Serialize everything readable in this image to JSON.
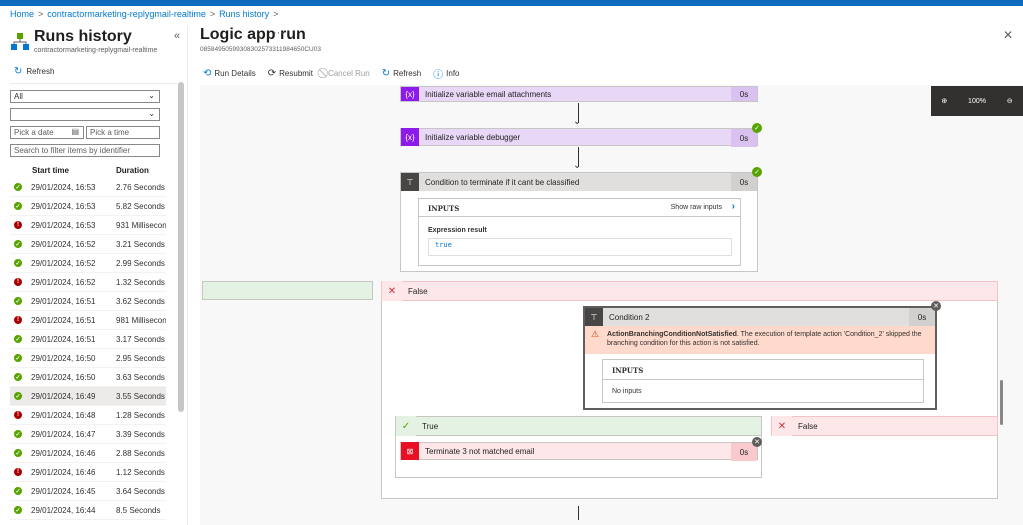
{
  "breadcrumb": {
    "home": "Home",
    "app": "contractormarketing-replygmail-realtime",
    "page": "Runs history",
    "trail_sep": ">"
  },
  "left": {
    "title": "Runs history",
    "subtitle": "contractormarketing-replygmail-realtime",
    "collapse": "«",
    "refresh": "Refresh",
    "filter_status": "All",
    "filter_blank": "",
    "date_placeholder": "Pick a date",
    "time_placeholder": "Pick a time",
    "search_placeholder": "Search to filter items by identifier",
    "col_start": "Start time",
    "col_duration": "Duration",
    "runs": [
      {
        "status": "ok",
        "time": "29/01/2024, 16:53",
        "duration": "2.76 Seconds"
      },
      {
        "status": "ok",
        "time": "29/01/2024, 16:53",
        "duration": "5.82 Seconds"
      },
      {
        "status": "err",
        "time": "29/01/2024, 16:53",
        "duration": "931 Milliseconds"
      },
      {
        "status": "ok",
        "time": "29/01/2024, 16:52",
        "duration": "3.21 Seconds"
      },
      {
        "status": "ok",
        "time": "29/01/2024, 16:52",
        "duration": "2.99 Seconds"
      },
      {
        "status": "err",
        "time": "29/01/2024, 16:52",
        "duration": "1.32 Seconds"
      },
      {
        "status": "ok",
        "time": "29/01/2024, 16:51",
        "duration": "3.62 Seconds"
      },
      {
        "status": "err",
        "time": "29/01/2024, 16:51",
        "duration": "981 Milliseconds"
      },
      {
        "status": "ok",
        "time": "29/01/2024, 16:51",
        "duration": "3.17 Seconds"
      },
      {
        "status": "ok",
        "time": "29/01/2024, 16:50",
        "duration": "2.95 Seconds"
      },
      {
        "status": "ok",
        "time": "29/01/2024, 16:50",
        "duration": "3.63 Seconds"
      },
      {
        "status": "ok",
        "time": "29/01/2024, 16:49",
        "duration": "3.55 Seconds"
      },
      {
        "status": "err",
        "time": "29/01/2024, 16:48",
        "duration": "1.28 Seconds"
      },
      {
        "status": "ok",
        "time": "29/01/2024, 16:47",
        "duration": "3.39 Seconds"
      },
      {
        "status": "ok",
        "time": "29/01/2024, 16:46",
        "duration": "2.88 Seconds"
      },
      {
        "status": "err",
        "time": "29/01/2024, 16:46",
        "duration": "1.12 Seconds"
      },
      {
        "status": "ok",
        "time": "29/01/2024, 16:45",
        "duration": "3.64 Seconds"
      },
      {
        "status": "ok",
        "time": "29/01/2024, 16:44",
        "duration": "8.5 Seconds"
      }
    ],
    "selected_index": 11
  },
  "main": {
    "title": "Logic app run",
    "more": "···",
    "run_id": "08584950599308302573311984650CU03",
    "close": "✕",
    "toolbar": {
      "run_details": "Run Details",
      "resubmit": "Resubmit",
      "cancel_run": "Cancel Run",
      "refresh": "Refresh",
      "info": "Info"
    },
    "zoom": {
      "level": "100%",
      "in": "⊕",
      "out": "⊖"
    }
  },
  "flow": {
    "var_attachments": {
      "label": "Initialize variable email attachments",
      "duration": "0s",
      "icon": "{x}"
    },
    "var_debugger": {
      "label": "Initialize variable debugger",
      "duration": "0s",
      "icon": "{x}"
    },
    "condition": {
      "label": "Condition to terminate if it cant be classified",
      "duration": "0s",
      "inputs_label": "INPUTS",
      "show_raw": "Show raw inputs",
      "expr_label": "Expression result",
      "expr_value": "true"
    },
    "false_branch": "False",
    "condition2": {
      "label": "Condition 2",
      "duration": "0s",
      "warn_bold": "ActionBranchingConditionNotSatisfied",
      "warn_text": ". The execution of template action 'Condition_2' skipped the branching condition for this action is not satisfied.",
      "inputs_label": "INPUTS",
      "no_inputs": "No inputs"
    },
    "true_branch": "True",
    "false_branch2": "False",
    "terminate": {
      "label": "Terminate 3 not matched email",
      "duration": "0s"
    }
  },
  "colors": {
    "accent": "#0078d4",
    "variable": "#e8d7f7",
    "variable_icon": "#8c1aea",
    "success": "#57a300",
    "error": "#a80000",
    "condition": "#e1dfdd",
    "condition_icon": "#484644",
    "false_bg": "#fde7e9",
    "true_bg": "#e3f2e3",
    "terminate_icon": "#e81123"
  }
}
